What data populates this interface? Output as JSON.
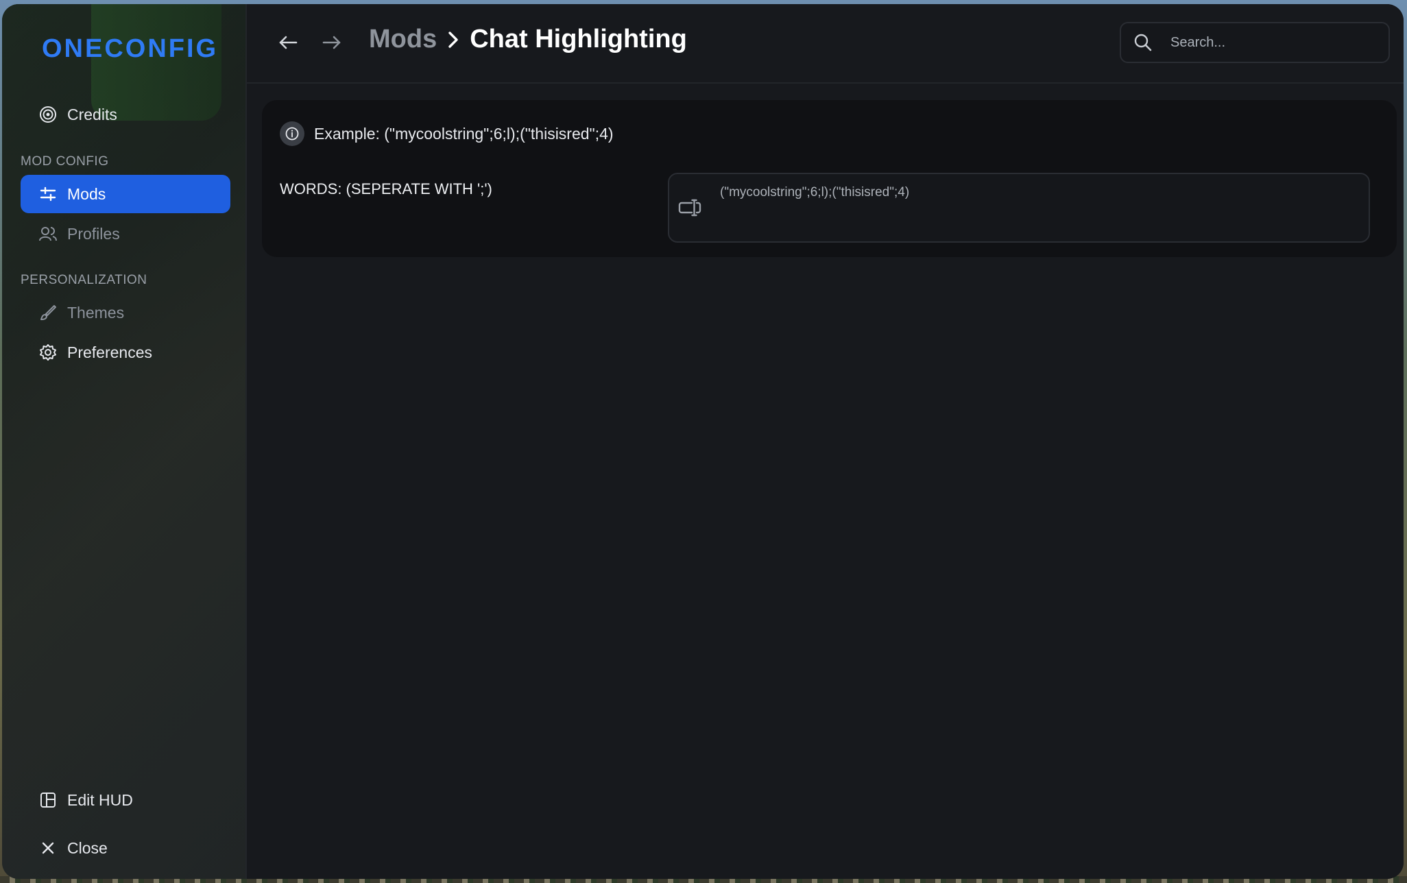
{
  "app": {
    "logo_text": "ONECONFIG",
    "accent_color": "#1f5fe0",
    "logo_color": "#2f7bf5"
  },
  "sidebar": {
    "credits": {
      "label": "Credits",
      "icon": "credits-icon"
    },
    "section_mod_config": "MOD CONFIG",
    "mods": {
      "label": "Mods",
      "icon": "sliders-icon",
      "active": true
    },
    "profiles": {
      "label": "Profiles",
      "icon": "users-icon"
    },
    "section_personalization": "PERSONALIZATION",
    "themes": {
      "label": "Themes",
      "icon": "brush-icon"
    },
    "preferences": {
      "label": "Preferences",
      "icon": "gear-icon"
    },
    "edit_hud": {
      "label": "Edit HUD",
      "icon": "layout-icon"
    },
    "close": {
      "label": "Close",
      "icon": "close-icon"
    }
  },
  "header": {
    "back_icon": "arrow-left-icon",
    "forward_icon": "arrow-right-icon",
    "breadcrumb_parent": "Mods",
    "breadcrumb_current": "Chat Highlighting",
    "search_placeholder": "Search..."
  },
  "content": {
    "info_text": "Example: (\"mycoolstring\";6;l);(\"thisisred\";4)",
    "words_label": "WORDS:  (SEPERATE WITH ';')",
    "words_value": "(\"mycoolstring\";6;l);(\"thisisred\";4)"
  }
}
